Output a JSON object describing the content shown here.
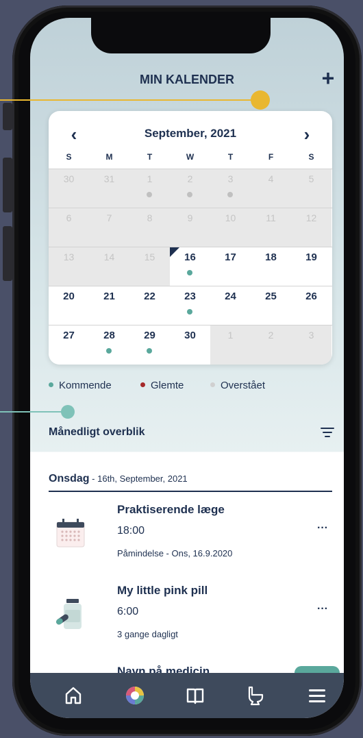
{
  "header": {
    "title": "MIN KALENDER",
    "add_label": "+"
  },
  "calendar": {
    "month_label": "September, 2021",
    "prev_label": "‹",
    "next_label": "›",
    "weekdays": [
      "S",
      "M",
      "T",
      "W",
      "T",
      "F",
      "S"
    ],
    "weeks": [
      [
        {
          "d": "30",
          "s": "outside"
        },
        {
          "d": "31",
          "s": "outside"
        },
        {
          "d": "1",
          "s": "past",
          "dot": "grey"
        },
        {
          "d": "2",
          "s": "past",
          "dot": "grey"
        },
        {
          "d": "3",
          "s": "past",
          "dot": "grey"
        },
        {
          "d": "4",
          "s": "past"
        },
        {
          "d": "5",
          "s": "past"
        }
      ],
      [
        {
          "d": "6",
          "s": "past"
        },
        {
          "d": "7",
          "s": "past"
        },
        {
          "d": "8",
          "s": "past"
        },
        {
          "d": "9",
          "s": "past"
        },
        {
          "d": "10",
          "s": "past"
        },
        {
          "d": "11",
          "s": "past"
        },
        {
          "d": "12",
          "s": "past"
        }
      ],
      [
        {
          "d": "13",
          "s": "past"
        },
        {
          "d": "14",
          "s": "past"
        },
        {
          "d": "15",
          "s": "past"
        },
        {
          "d": "16",
          "s": "future",
          "dot": "teal",
          "today": true
        },
        {
          "d": "17",
          "s": "future"
        },
        {
          "d": "18",
          "s": "future"
        },
        {
          "d": "19",
          "s": "future"
        }
      ],
      [
        {
          "d": "20",
          "s": "future"
        },
        {
          "d": "21",
          "s": "future"
        },
        {
          "d": "22",
          "s": "future"
        },
        {
          "d": "23",
          "s": "future",
          "dot": "teal"
        },
        {
          "d": "24",
          "s": "future"
        },
        {
          "d": "25",
          "s": "future"
        },
        {
          "d": "26",
          "s": "future"
        }
      ],
      [
        {
          "d": "27",
          "s": "future"
        },
        {
          "d": "28",
          "s": "future",
          "dot": "teal"
        },
        {
          "d": "29",
          "s": "future",
          "dot": "teal"
        },
        {
          "d": "30",
          "s": "future"
        },
        {
          "d": "1",
          "s": "outside"
        },
        {
          "d": "2",
          "s": "outside"
        },
        {
          "d": "3",
          "s": "outside"
        }
      ]
    ]
  },
  "legend": {
    "upcoming": "Kommende",
    "forgotten": "Glemte",
    "passed": "Overstået"
  },
  "overview": {
    "title": "Månedligt overblik"
  },
  "day": {
    "name": "Onsdag",
    "date": " - 16th, September, 2021"
  },
  "events": [
    {
      "title": "Praktiserende læge",
      "time": "18:00",
      "sub": "Påmindelse - Ons, 16.9.2020",
      "icon": "calendar-icon",
      "menu": "···"
    },
    {
      "title": "My little pink pill",
      "time": "6:00",
      "sub": "3 gange dagligt",
      "icon": "pill-bottle-icon",
      "menu": "···"
    }
  ],
  "partial_event_title": "Navn på medicin",
  "colors": {
    "navy": "#1e3050",
    "teal": "#5aa89c",
    "red": "#a52a2a",
    "grey_dot": "#c0c0c0",
    "callout_yellow": "#e9b730",
    "callout_teal": "#7fc2b8",
    "nav_bg": "#3e4a5c"
  },
  "nav": [
    "home-icon",
    "color-wheel-icon",
    "book-icon",
    "toilet-icon",
    "menu-icon"
  ]
}
